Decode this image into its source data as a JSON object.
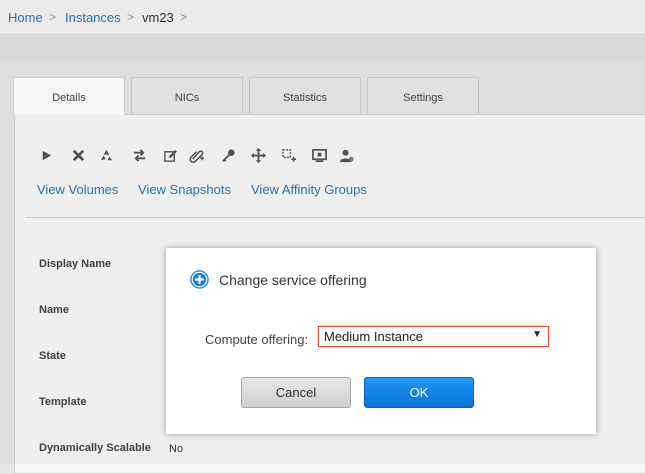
{
  "breadcrumb": {
    "items": [
      "Home",
      "Instances",
      "vm23"
    ],
    "separator": ">"
  },
  "tabs": [
    {
      "label": "Details"
    },
    {
      "label": "NICs"
    },
    {
      "label": "Statistics"
    },
    {
      "label": "Settings"
    }
  ],
  "toolbar": {
    "icons": [
      "play-icon",
      "destroy-icon",
      "recycle-icon",
      "migrate-icon",
      "edit-icon",
      "attach-iso-icon",
      "reset-key-icon",
      "move-icon",
      "scale-icon",
      "console-icon",
      "assign-user-icon"
    ]
  },
  "links": {
    "volumes": "View Volumes",
    "snapshots": "View Snapshots",
    "affinity": "View Affinity Groups"
  },
  "details": {
    "display_name_label": "Display Name",
    "name_label": "Name",
    "state_label": "State",
    "template_label": "Template",
    "dynamic_label": "Dynamically Scalable",
    "dynamic_value": "No"
  },
  "dialog": {
    "title": "Change service offering",
    "compute_label": "Compute offering:",
    "compute_value": "Medium Instance",
    "cancel_label": "Cancel",
    "ok_label": "OK"
  },
  "colors": {
    "link": "#2e75b6",
    "ok_button": "#0b74d9",
    "select_border": "#e0523c"
  }
}
